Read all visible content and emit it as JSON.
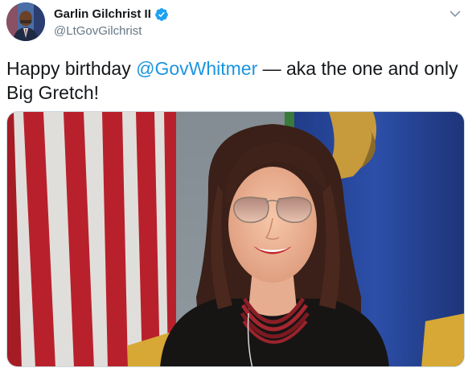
{
  "tweet": {
    "author": {
      "display_name": "Garlin Gilchrist II",
      "handle": "@LtGovGilchrist",
      "verified": true
    },
    "text": {
      "prefix": "Happy birthday ",
      "mention": "@GovWhitmer",
      "suffix": " — aka the one and only Big Gretch!"
    },
    "media": {
      "type": "photo"
    },
    "icons": {
      "verified": "verified-badge-icon",
      "more": "chevron-down-icon"
    }
  },
  "colors": {
    "accent": "#1b95e0",
    "verified": "#1da1f2",
    "text": "#14171a",
    "secondary": "#657786"
  }
}
